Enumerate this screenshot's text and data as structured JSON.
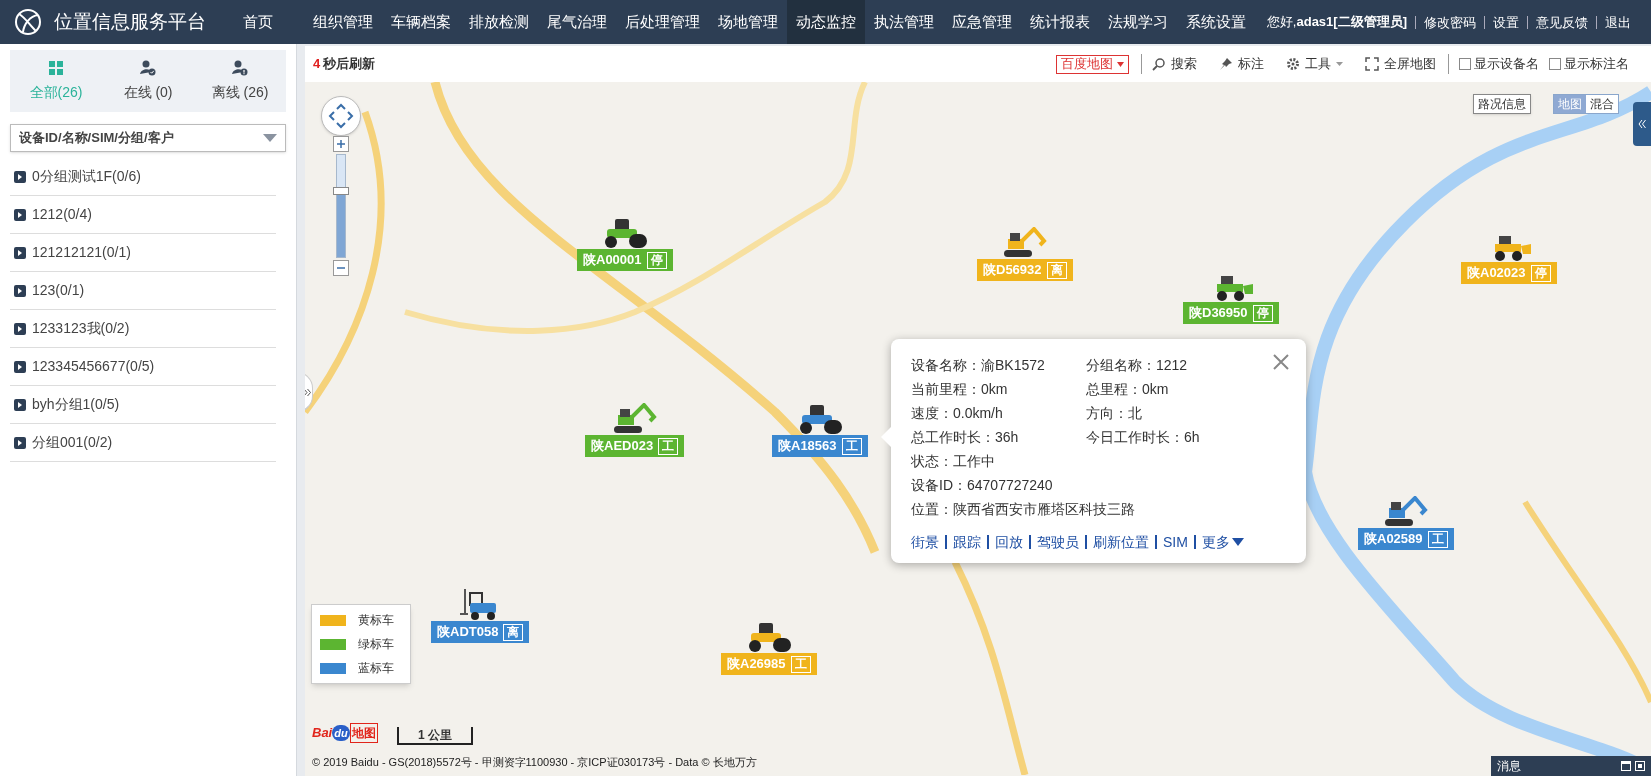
{
  "header": {
    "title": "位置信息服务平台",
    "nav": [
      {
        "label": "首页",
        "selected": false
      },
      {
        "label": "组织管理",
        "selected": false
      },
      {
        "label": "车辆档案",
        "selected": false
      },
      {
        "label": "排放检测",
        "selected": false
      },
      {
        "label": "尾气治理",
        "selected": false
      },
      {
        "label": "后处理管理",
        "selected": false
      },
      {
        "label": "场地管理",
        "selected": false
      },
      {
        "label": "动态监控",
        "selected": true
      },
      {
        "label": "执法管理",
        "selected": false
      },
      {
        "label": "应急管理",
        "selected": false
      },
      {
        "label": "统计报表",
        "selected": false
      },
      {
        "label": "法规学习",
        "selected": false
      },
      {
        "label": "系统设置",
        "selected": false
      }
    ],
    "greeting": "您好,**adas1[二级管理员]**",
    "links": [
      "修改密码",
      "设置",
      "意见反馈",
      "退出"
    ]
  },
  "sidebar": {
    "tabs": [
      {
        "kind": "all",
        "label": "全部(26)",
        "selected": true
      },
      {
        "kind": "online",
        "label": "在线 (0)",
        "selected": false
      },
      {
        "kind": "offline",
        "label": "离线 (26)",
        "selected": false
      }
    ],
    "search": {
      "placeholder": "设备ID/名称/SIM/分组/客户"
    },
    "groups": [
      {
        "label": "0分组测试1F(0/6)",
        "expanded": false
      },
      {
        "label": "1212(0/4)",
        "expanded": false
      },
      {
        "label": "121212121(0/1)",
        "expanded": false
      },
      {
        "label": "123(0/1)",
        "expanded": false
      },
      {
        "label": "1233123我(0/2)",
        "expanded": false
      },
      {
        "label": "123345456677(0/5)",
        "expanded": false
      },
      {
        "label": "byh分组1(0/5)",
        "expanded": false
      },
      {
        "label": "分组001(0/2)",
        "expanded": false
      }
    ]
  },
  "toolbar": {
    "countdown": "4",
    "refresh_text": "秒后刷新",
    "map_type": "百度地图",
    "tools": [
      {
        "kind": "search",
        "label": "搜索"
      },
      {
        "kind": "pin",
        "label": "标注"
      },
      {
        "kind": "gear",
        "label": "工具"
      },
      {
        "kind": "fullscreen",
        "label": "全屏地图"
      }
    ],
    "checkboxes": [
      {
        "label": "显示设备名",
        "checked": false
      },
      {
        "label": "显示标注名",
        "checked": false
      }
    ]
  },
  "map": {
    "zoom": {
      "level": 0.65
    },
    "traffic_button": "路况信息",
    "map_modes": [
      {
        "label": "地图",
        "selected": true
      },
      {
        "label": "混合",
        "selected": false
      }
    ],
    "vehicles": [
      {
        "kind": "roller",
        "plate": "陕A00001",
        "status": "停",
        "color": "#5cb531"
      },
      {
        "kind": "excavator",
        "plate": "陕D56932",
        "status": "离",
        "color": "#f0b41c"
      },
      {
        "kind": "loader",
        "plate": "陕D36950",
        "status": "停",
        "color": "#5cb531"
      },
      {
        "kind": "loader",
        "plate": "陕A02023",
        "status": "停",
        "color": "#f0b41c"
      },
      {
        "kind": "excavator",
        "plate": "陕AED023",
        "status": "工",
        "color": "#5cb531"
      },
      {
        "kind": "roller",
        "plate": "陕A18563",
        "status": "工",
        "color": "#3a87cf"
      },
      {
        "kind": "excavator",
        "plate": "陕A02589",
        "status": "工",
        "color": "#3a87cf"
      },
      {
        "kind": "forklift",
        "plate": "陕ADT058",
        "status": "离",
        "color": "#3a87cf"
      },
      {
        "kind": "roller",
        "plate": "陕A26985",
        "status": "工",
        "color": "#f0b41c"
      }
    ],
    "popup": {
      "rows": [
        [
          "设备名称：渝BK1572",
          "分组名称：1212"
        ],
        [
          "当前里程：0km",
          "总里程：0km"
        ],
        [
          "速度：0.0km/h",
          "方向：北"
        ],
        [
          "总工作时长：36h",
          "今日工作时长：6h"
        ],
        [
          "状态：工作中"
        ],
        [
          "设备ID：64707727240"
        ],
        [
          "位置：陕西省西安市雁塔区科技三路"
        ]
      ],
      "links": [
        "街景",
        "跟踪",
        "回放",
        "驾驶员",
        "刷新位置",
        "SIM",
        "更多"
      ]
    },
    "legend": [
      {
        "label": "黄标车",
        "color": "#f0b41c"
      },
      {
        "label": "绿标车",
        "color": "#5cb531"
      },
      {
        "label": "蓝标车",
        "color": "#3a87cf"
      }
    ],
    "logo": {
      "part_1": "Bai",
      "part_2": "du",
      "part_3": "地图"
    },
    "scale": "1 公里",
    "copyright": "© 2019 Baidu - GS(2018)5572号 - 甲测资字1100930 - 京ICP证030173号 - Data © 长地万方"
  },
  "message_bar": {
    "label": "消息"
  }
}
